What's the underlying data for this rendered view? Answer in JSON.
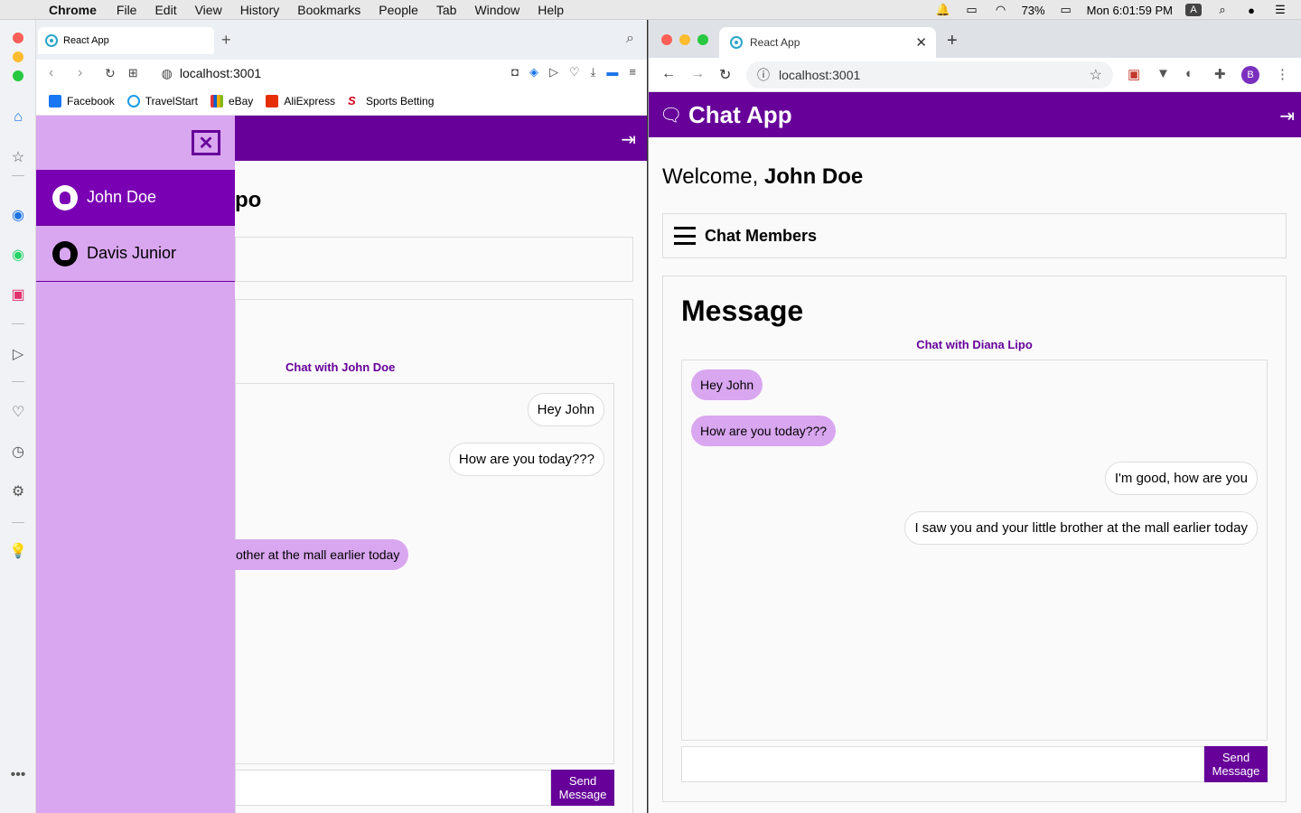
{
  "menubar": {
    "items": [
      "Chrome",
      "File",
      "Edit",
      "View",
      "History",
      "Bookmarks",
      "People",
      "Tab",
      "Window",
      "Help"
    ],
    "battery": "73%",
    "clock": "Mon 6:01:59 PM",
    "input_badge": "A"
  },
  "left_browser": {
    "tab_title": "React App",
    "url": "localhost:3001",
    "bookmarks": [
      {
        "label": "Facebook",
        "color": "#1877f2"
      },
      {
        "label": "TravelStart",
        "color": "#1e9be9"
      },
      {
        "label": "eBay",
        "color": "#e53238"
      },
      {
        "label": "AliExpress",
        "color": "#e62e04"
      },
      {
        "label": "Sports Betting",
        "color": "#d0021b"
      }
    ],
    "page": {
      "welcome_tail": "po",
      "chat_with": "Chat with John Doe",
      "messages": [
        {
          "text": "Hey John",
          "dir": "out"
        },
        {
          "text": "How are you today???",
          "dir": "out"
        },
        {
          "text": "other at the mall earlier today",
          "dir": "in"
        }
      ],
      "send_label": "Send Message"
    },
    "drawer": {
      "close_symbol": "✕",
      "members": [
        "John Doe",
        "Davis Junior"
      ]
    }
  },
  "right_browser": {
    "tab_title": "React App",
    "url": "localhost:3001",
    "profile_initial": "B",
    "app": {
      "title": "Chat App",
      "welcome_prefix": "Welcome, ",
      "welcome_name": "John Doe",
      "members_label": "Chat Members",
      "message_title": "Message",
      "chat_with": "Chat with Diana Lipo",
      "messages": [
        {
          "text": "Hey John",
          "dir": "in"
        },
        {
          "text": "How are you today???",
          "dir": "in"
        },
        {
          "text": "I'm good, how are you",
          "dir": "out"
        },
        {
          "text": "I saw you and your little brother at the mall earlier today",
          "dir": "out"
        }
      ],
      "send_label": "Send Message"
    }
  },
  "colors": {
    "brand": "#660099",
    "bubble_in": "#d9a6f0",
    "drawer": "#d9a6f0",
    "drawer_active": "#7a00b3"
  }
}
